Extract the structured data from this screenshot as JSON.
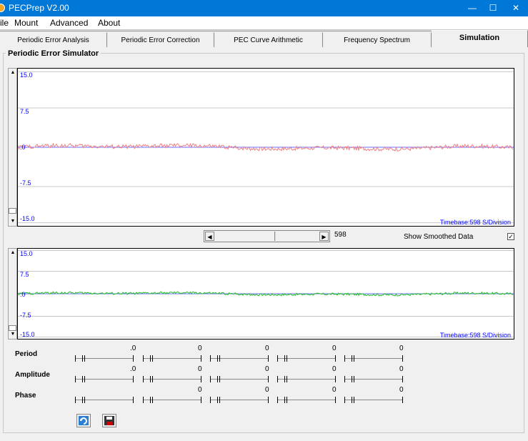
{
  "window": {
    "title": "PECPrep V2.00",
    "min": "—",
    "max": "☐",
    "close": "✕"
  },
  "menu": [
    "ile",
    "Mount",
    "Advanced",
    "About"
  ],
  "tabs": [
    {
      "label": "Periodic Error Analysis"
    },
    {
      "label": "Periodic Error Correction"
    },
    {
      "label": "PEC Curve Arithmetic"
    },
    {
      "label": "Frequency Spectrum"
    },
    {
      "label": "Simulation",
      "active": true
    }
  ],
  "simulator": {
    "title": "Periodic Error Simulator",
    "top_plot": {
      "y_labels": [
        "15.0",
        "7.5",
        ".0",
        "-7.5",
        "-15.0"
      ],
      "timebase": "Timebase:598 S/Division",
      "line_color": "#ef7f7f"
    },
    "bottom_plot": {
      "y_labels": [
        "15.0",
        "7.5",
        ".0",
        "-7.5",
        "-15.0"
      ],
      "timebase": "Timebase:598 S/Division",
      "line_color": "#1fbf1f"
    },
    "zero_line_color": "#6a6aff",
    "scroll_value": "598",
    "show_smoothed_label": "Show Smoothed Data",
    "show_smoothed_mark": "✓",
    "show_smoothed_checked": true
  },
  "controls": {
    "period": {
      "label": "Period",
      "values": [
        ".0",
        "0",
        "0",
        "0",
        "0"
      ]
    },
    "amplitude": {
      "label": "Amplitude",
      "values": [
        ".0",
        "0",
        "0",
        "0",
        "0"
      ]
    },
    "phase": {
      "label": "Phase",
      "values": [
        "0",
        "0",
        "0",
        "0"
      ]
    }
  },
  "toolbar": {
    "refresh_icon": "refresh-icon",
    "save_icon": "floppy-icon"
  }
}
